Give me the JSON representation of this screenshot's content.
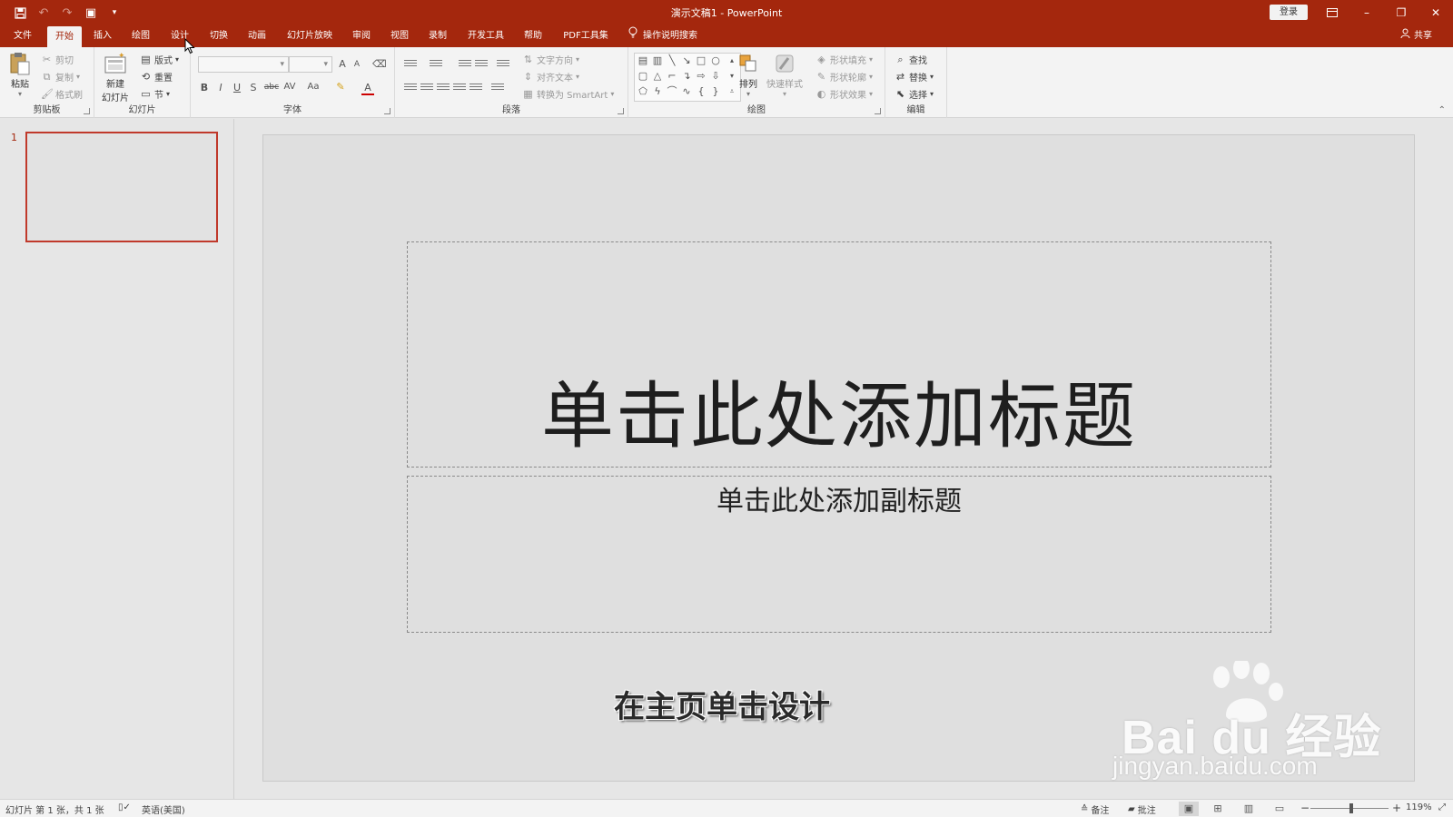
{
  "window": {
    "title": "演示文稿1 - PowerPoint",
    "login_label": "登录",
    "controls": [
      "ribbon-display",
      "minimize",
      "restore",
      "close"
    ]
  },
  "qat": {
    "icons": [
      "save-icon",
      "undo-icon",
      "redo-icon",
      "start-from-beginning-icon",
      "customize-qat-icon"
    ]
  },
  "tabs": [
    {
      "label": "文件",
      "active": false
    },
    {
      "label": "开始",
      "active": true
    },
    {
      "label": "插入",
      "active": false
    },
    {
      "label": "绘图",
      "active": false
    },
    {
      "label": "设计",
      "active": false
    },
    {
      "label": "切换",
      "active": false
    },
    {
      "label": "动画",
      "active": false
    },
    {
      "label": "幻灯片放映",
      "active": false
    },
    {
      "label": "审阅",
      "active": false
    },
    {
      "label": "视图",
      "active": false
    },
    {
      "label": "录制",
      "active": false
    },
    {
      "label": "开发工具",
      "active": false
    },
    {
      "label": "帮助",
      "active": false
    },
    {
      "label": "PDF工具集",
      "active": false
    }
  ],
  "tell_me": "操作说明搜索",
  "share": "共享",
  "ribbon": {
    "clipboard": {
      "label": "剪贴板",
      "paste": "粘贴",
      "cut": "剪切",
      "copy": "复制",
      "format_painter": "格式刷"
    },
    "slides": {
      "label": "幻灯片",
      "new_slide_line1": "新建",
      "new_slide_line2": "幻灯片",
      "layout": "版式",
      "reset": "重置",
      "section": "节"
    },
    "font": {
      "label": "字体",
      "font_name": "",
      "font_size": "",
      "bold": "B",
      "italic": "I",
      "underline": "U",
      "shadow": "S",
      "strikethrough": "abc",
      "spacing": "AV",
      "change_case": "Aa",
      "grow": "A",
      "shrink": "A",
      "color": "A"
    },
    "paragraph": {
      "label": "段落",
      "text_direction": "文字方向",
      "align_text": "对齐文本",
      "convert_smartart": "转换为 SmartArt"
    },
    "drawing": {
      "label": "绘图",
      "arrange": "排列",
      "quick_styles": "快速样式",
      "shape_fill": "形状填充",
      "shape_outline": "形状轮廓",
      "shape_effects": "形状效果"
    },
    "editing": {
      "label": "编辑",
      "find": "查找",
      "replace": "替换",
      "select": "选择"
    }
  },
  "thumbnails": [
    {
      "number": "1"
    }
  ],
  "slide": {
    "title_placeholder": "单击此处添加标题",
    "subtitle_placeholder": "单击此处添加副标题"
  },
  "annotation": "在主页单击设计",
  "watermark": {
    "brand": "Bai du 经验",
    "url": "jingyan.baidu.com"
  },
  "statusbar": {
    "slide_info": "幻灯片 第 1 张，共 1 张",
    "language": "英语(美国)",
    "notes": "备注",
    "comments": "批注",
    "zoom_out": "−",
    "zoom_in": "+",
    "zoom_level": "119%",
    "zoom_fraction": 0.52
  },
  "colors": {
    "accent": "#a4270d",
    "ribbon_bg": "#f3f3f3",
    "selected_thumb_border": "#c0392b"
  }
}
